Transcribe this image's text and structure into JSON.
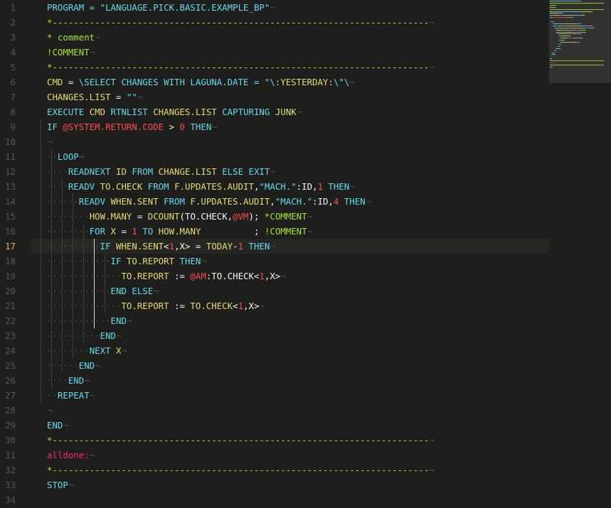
{
  "editor": {
    "active_line": 17,
    "lines": [
      [
        {
          "t": "PROGRAM = ",
          "c": "kw"
        },
        {
          "t": "\"LANGUAGE.PICK.BASIC.EXAMPLE_BP\"",
          "c": "str"
        },
        {
          "t": "¬",
          "c": "ws"
        }
      ],
      [
        {
          "t": "*-----------------------------------------------------------------------",
          "c": "cmt"
        },
        {
          "t": "¬",
          "c": "ws"
        }
      ],
      [
        {
          "t": "* comment",
          "c": "cmt"
        },
        {
          "t": "¬",
          "c": "ws"
        }
      ],
      [
        {
          "t": "!COMMENT",
          "c": "cmt"
        },
        {
          "t": "¬",
          "c": "ws"
        }
      ],
      [
        {
          "t": "*-----------------------------------------------------------------------",
          "c": "cmt"
        },
        {
          "t": "¬",
          "c": "ws"
        }
      ],
      [
        {
          "t": "CMD",
          "c": "ex"
        },
        {
          "t": " = ",
          "c": "plain"
        },
        {
          "t": "\\SELECT CHANGES WITH LAGUNA.DATE = \"\\",
          "c": "str"
        },
        {
          "t": ":YESTERDAY:",
          "c": "ex"
        },
        {
          "t": "\\\"\\",
          "c": "str"
        },
        {
          "t": "¬",
          "c": "ws"
        }
      ],
      [
        {
          "t": "CHANGES.LIST",
          "c": "ex"
        },
        {
          "t": " = ",
          "c": "plain"
        },
        {
          "t": "\"\"",
          "c": "str"
        },
        {
          "t": "¬",
          "c": "ws"
        }
      ],
      [
        {
          "t": "EXECUTE ",
          "c": "kw"
        },
        {
          "t": "CMD",
          "c": "ex"
        },
        {
          "t": " RTNLIST ",
          "c": "kw"
        },
        {
          "t": "CHANGES.LIST",
          "c": "ex"
        },
        {
          "t": " CAPTURING ",
          "c": "kw"
        },
        {
          "t": "JUNK",
          "c": "ex"
        },
        {
          "t": "¬",
          "c": "ws"
        }
      ],
      [
        {
          "t": "IF ",
          "c": "kw"
        },
        {
          "t": "@SYSTEM.RETURN.CODE",
          "c": "sysvar"
        },
        {
          "t": " > ",
          "c": "plain"
        },
        {
          "t": "0",
          "c": "num"
        },
        {
          "t": " THEN",
          "c": "kw"
        },
        {
          "t": "¬",
          "c": "ws"
        }
      ],
      [
        {
          "t": "¬",
          "c": "ws"
        }
      ],
      [
        {
          "t": "··",
          "c": "ws"
        },
        {
          "t": "LOOP",
          "c": "kw"
        },
        {
          "t": "¬",
          "c": "ws"
        }
      ],
      [
        {
          "t": "····",
          "c": "ws"
        },
        {
          "t": "READNEXT ",
          "c": "kw"
        },
        {
          "t": "ID",
          "c": "ex"
        },
        {
          "t": " FROM ",
          "c": "kw"
        },
        {
          "t": "CHANGE.LIST",
          "c": "ex"
        },
        {
          "t": " ELSE EXIT",
          "c": "kw"
        },
        {
          "t": "¬",
          "c": "ws"
        }
      ],
      [
        {
          "t": "····",
          "c": "ws"
        },
        {
          "t": "READV ",
          "c": "kw"
        },
        {
          "t": "TO.CHECK",
          "c": "ex"
        },
        {
          "t": " FROM ",
          "c": "kw"
        },
        {
          "t": "F.UPDATES.AUDIT",
          "c": "ex"
        },
        {
          "t": ",",
          "c": "plain"
        },
        {
          "t": "\"MACH.\"",
          "c": "str"
        },
        {
          "t": ":ID,",
          "c": "plain"
        },
        {
          "t": "1",
          "c": "num"
        },
        {
          "t": " THEN",
          "c": "kw"
        },
        {
          "t": "¬",
          "c": "ws"
        }
      ],
      [
        {
          "t": "······",
          "c": "ws"
        },
        {
          "t": "READV ",
          "c": "kw"
        },
        {
          "t": "WHEN.SENT",
          "c": "ex"
        },
        {
          "t": " FROM ",
          "c": "kw"
        },
        {
          "t": "F.UPDATES.AUDIT",
          "c": "ex"
        },
        {
          "t": ",",
          "c": "plain"
        },
        {
          "t": "\"MACH.\"",
          "c": "str"
        },
        {
          "t": ":ID,",
          "c": "plain"
        },
        {
          "t": "4",
          "c": "num"
        },
        {
          "t": " THEN",
          "c": "kw"
        },
        {
          "t": "¬",
          "c": "ws"
        }
      ],
      [
        {
          "t": "········",
          "c": "ws"
        },
        {
          "t": "HOW.MANY",
          "c": "ex"
        },
        {
          "t": " = ",
          "c": "plain"
        },
        {
          "t": "DCOUNT",
          "c": "ex"
        },
        {
          "t": "(TO.CHECK,",
          "c": "plain"
        },
        {
          "t": "@VM",
          "c": "sysvar"
        },
        {
          "t": "); ",
          "c": "plain"
        },
        {
          "t": "*COMMENT",
          "c": "cmt"
        },
        {
          "t": "¬",
          "c": "ws"
        }
      ],
      [
        {
          "t": "········",
          "c": "ws"
        },
        {
          "t": "FOR ",
          "c": "kw"
        },
        {
          "t": "X",
          "c": "ex"
        },
        {
          "t": " = ",
          "c": "plain"
        },
        {
          "t": "1",
          "c": "num"
        },
        {
          "t": " TO ",
          "c": "kw"
        },
        {
          "t": "HOW.MANY",
          "c": "ex"
        },
        {
          "t": "          ; ",
          "c": "plain"
        },
        {
          "t": "!COMMENT",
          "c": "cmt"
        },
        {
          "t": "¬",
          "c": "ws"
        }
      ],
      [
        {
          "t": "··········",
          "c": "ws"
        },
        {
          "t": "IF ",
          "c": "kw"
        },
        {
          "t": "WHEN.SENT",
          "c": "ex"
        },
        {
          "t": "<",
          "c": "plain"
        },
        {
          "t": "1",
          "c": "num"
        },
        {
          "t": ",X> = ",
          "c": "plain"
        },
        {
          "t": "TODAY",
          "c": "ex"
        },
        {
          "t": "-",
          "c": "plain"
        },
        {
          "t": "1",
          "c": "num"
        },
        {
          "t": " THEN",
          "c": "kw"
        },
        {
          "t": "¬",
          "c": "ws"
        }
      ],
      [
        {
          "t": "············",
          "c": "ws"
        },
        {
          "t": "IF ",
          "c": "kw"
        },
        {
          "t": "TO.REPORT",
          "c": "ex"
        },
        {
          "t": " THEN",
          "c": "kw"
        },
        {
          "t": "¬",
          "c": "ws"
        }
      ],
      [
        {
          "t": "··············",
          "c": "ws"
        },
        {
          "t": "TO.REPORT",
          "c": "ex"
        },
        {
          "t": " := ",
          "c": "plain"
        },
        {
          "t": "@AM",
          "c": "sysvar"
        },
        {
          "t": ":TO.CHECK<",
          "c": "plain"
        },
        {
          "t": "1",
          "c": "num"
        },
        {
          "t": ",X>",
          "c": "plain"
        },
        {
          "t": "¬",
          "c": "ws"
        }
      ],
      [
        {
          "t": "············",
          "c": "ws"
        },
        {
          "t": "END ELSE",
          "c": "kw"
        },
        {
          "t": "¬",
          "c": "ws"
        }
      ],
      [
        {
          "t": "··············",
          "c": "ws"
        },
        {
          "t": "TO.REPORT",
          "c": "ex"
        },
        {
          "t": " := ",
          "c": "plain"
        },
        {
          "t": "TO.CHECK",
          "c": "ex"
        },
        {
          "t": "<",
          "c": "plain"
        },
        {
          "t": "1",
          "c": "num"
        },
        {
          "t": ",X>",
          "c": "plain"
        },
        {
          "t": "¬",
          "c": "ws"
        }
      ],
      [
        {
          "t": "············",
          "c": "ws"
        },
        {
          "t": "END",
          "c": "kw"
        },
        {
          "t": "¬",
          "c": "ws"
        }
      ],
      [
        {
          "t": "··········",
          "c": "ws"
        },
        {
          "t": "END",
          "c": "kw"
        },
        {
          "t": "¬",
          "c": "ws"
        }
      ],
      [
        {
          "t": "········",
          "c": "ws"
        },
        {
          "t": "NEXT ",
          "c": "kw"
        },
        {
          "t": "X",
          "c": "ex"
        },
        {
          "t": "¬",
          "c": "ws"
        }
      ],
      [
        {
          "t": "······",
          "c": "ws"
        },
        {
          "t": "END",
          "c": "kw"
        },
        {
          "t": "¬",
          "c": "ws"
        }
      ],
      [
        {
          "t": "····",
          "c": "ws"
        },
        {
          "t": "END",
          "c": "kw"
        },
        {
          "t": "¬",
          "c": "ws"
        }
      ],
      [
        {
          "t": "··",
          "c": "ws"
        },
        {
          "t": "REPEAT",
          "c": "kw"
        },
        {
          "t": "¬",
          "c": "ws"
        }
      ],
      [
        {
          "t": "¬",
          "c": "ws"
        }
      ],
      [
        {
          "t": "END",
          "c": "kw"
        },
        {
          "t": "¬",
          "c": "ws"
        }
      ],
      [
        {
          "t": "*-----------------------------------------------------------------------",
          "c": "cmt"
        },
        {
          "t": "¬",
          "c": "ws"
        }
      ],
      [
        {
          "t": "alldone:",
          "c": "lbl"
        },
        {
          "t": "¬",
          "c": "ws"
        }
      ],
      [
        {
          "t": "*-----------------------------------------------------------------------",
          "c": "cmt"
        },
        {
          "t": "¬",
          "c": "ws"
        }
      ],
      [
        {
          "t": "STOP",
          "c": "kw"
        },
        {
          "t": "¬",
          "c": "ws"
        }
      ],
      []
    ]
  },
  "colors": {
    "background": "#1e1f1c",
    "keyword": "#66d9ef",
    "identifier": "#e6db74",
    "number": "#ff4a52",
    "comment": "#a6e22e",
    "label": "#f92672",
    "line_number": "#56574f",
    "line_number_active": "#e6b457"
  }
}
